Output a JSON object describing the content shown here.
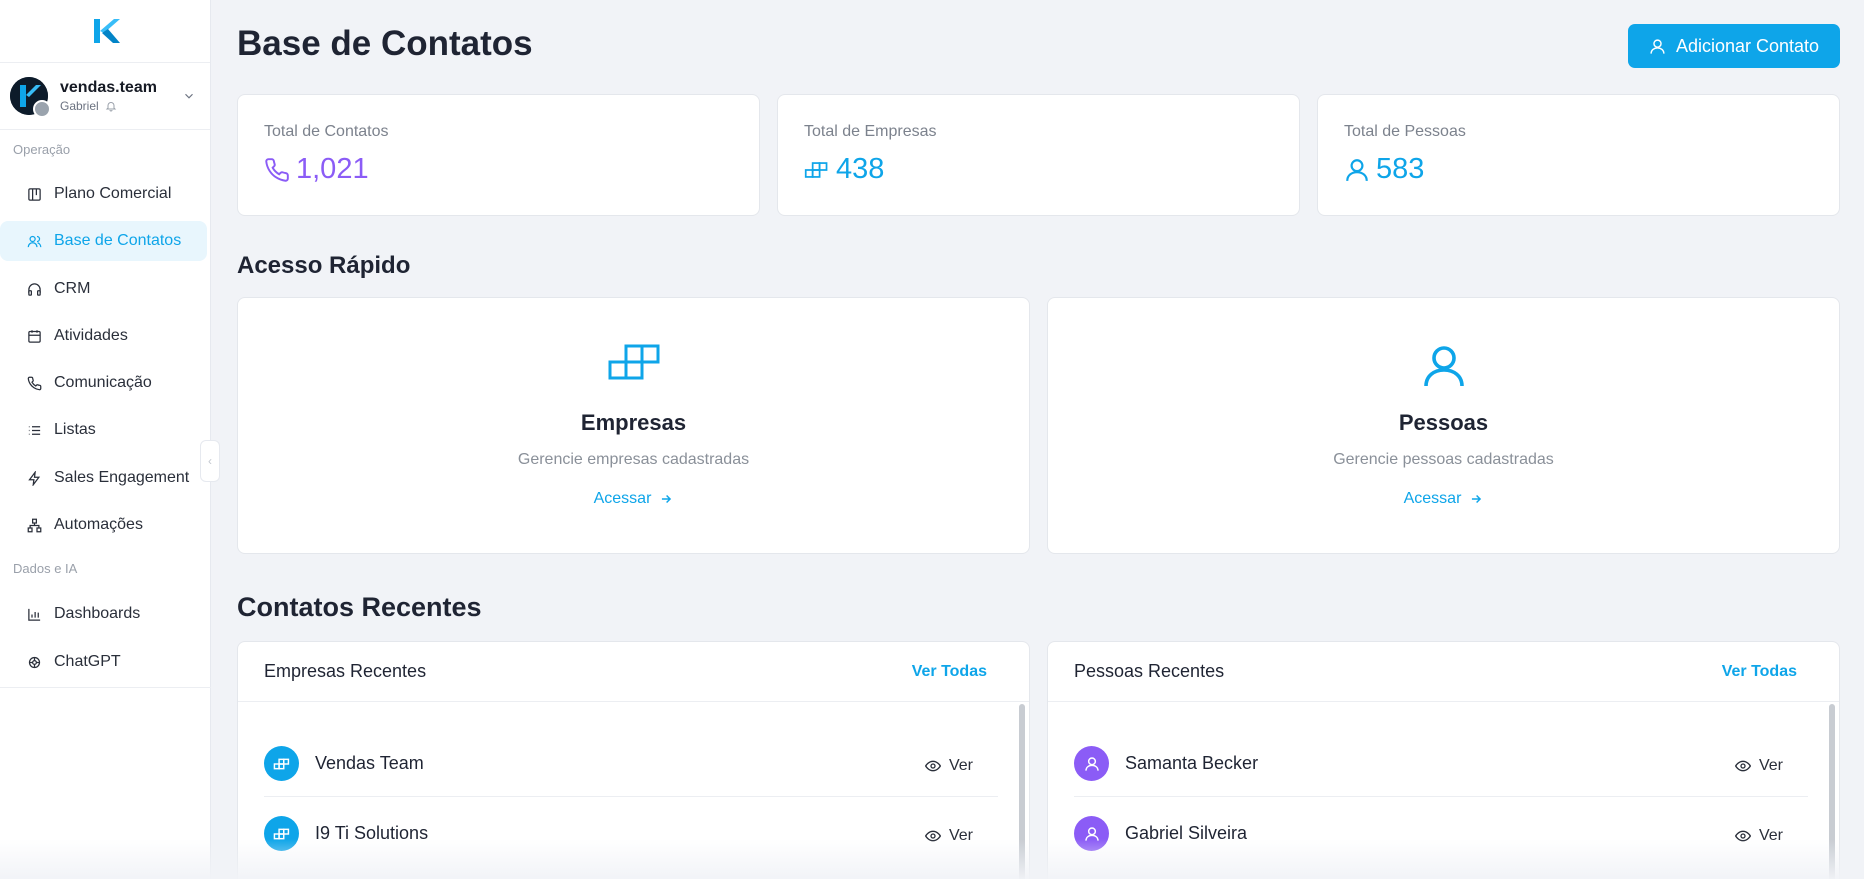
{
  "colors": {
    "accent": "#0ea5e9",
    "purple": "#8b5cf6",
    "blue_stat": "#0ea5e9"
  },
  "workspace": {
    "name": "vendas.team",
    "user": "Gabriel"
  },
  "sidebar": {
    "section_operacao": "Operação",
    "section_dados": "Dados e IA",
    "items": [
      {
        "label": "Plano Comercial",
        "icon": "board-icon"
      },
      {
        "label": "Base de Contatos",
        "icon": "contacts-icon",
        "active": true
      },
      {
        "label": "CRM",
        "icon": "headphones-icon"
      },
      {
        "label": "Atividades",
        "icon": "calendar-icon"
      },
      {
        "label": "Comunicação",
        "icon": "phone-icon"
      },
      {
        "label": "Listas",
        "icon": "list-icon"
      },
      {
        "label": "Sales Engagement",
        "icon": "bolt-icon"
      },
      {
        "label": "Automações",
        "icon": "workflow-icon"
      },
      {
        "label": "Dashboards",
        "icon": "bar-chart-icon"
      },
      {
        "label": "ChatGPT",
        "icon": "openai-icon"
      }
    ]
  },
  "header": {
    "title": "Base de Contatos",
    "add_button": "Adicionar Contato"
  },
  "stats": [
    {
      "label": "Total de Contatos",
      "value": "1,021",
      "icon": "phone-icon",
      "color": "#8b5cf6"
    },
    {
      "label": "Total de Empresas",
      "value": "438",
      "icon": "blocks-icon",
      "color": "#0ea5e9"
    },
    {
      "label": "Total de Pessoas",
      "value": "583",
      "icon": "user-icon",
      "color": "#0ea5e9"
    }
  ],
  "quick_access": {
    "title": "Acesso Rápido",
    "cards": [
      {
        "title": "Empresas",
        "desc": "Gerencie empresas cadastradas",
        "link": "Acessar"
      },
      {
        "title": "Pessoas",
        "desc": "Gerencie pessoas cadastradas",
        "link": "Acessar"
      }
    ]
  },
  "recent": {
    "title": "Contatos Recentes",
    "companies": {
      "title": "Empresas Recentes",
      "link": "Ver Todas",
      "rows": [
        {
          "name": "Vendas Team",
          "action": "Ver"
        },
        {
          "name": "I9 Ti Solutions",
          "action": "Ver"
        }
      ]
    },
    "people": {
      "title": "Pessoas Recentes",
      "link": "Ver Todas",
      "rows": [
        {
          "name": "Samanta Becker",
          "action": "Ver"
        },
        {
          "name": "Gabriel Silveira",
          "action": "Ver"
        }
      ]
    }
  }
}
